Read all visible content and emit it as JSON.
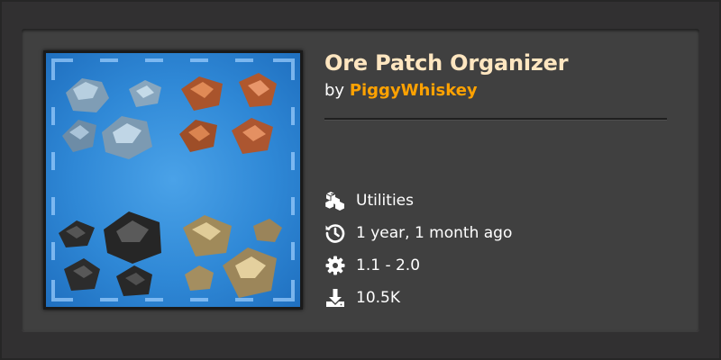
{
  "mod": {
    "title": "Ore Patch Organizer",
    "by_label": "by",
    "author": "PiggyWhiskey"
  },
  "meta": [
    {
      "icon": "cubes-icon",
      "text": "Utilities"
    },
    {
      "icon": "history-icon",
      "text": "1 year, 1 month ago"
    },
    {
      "icon": "gear-icon",
      "text": "1.1 - 2.0"
    },
    {
      "icon": "download-icon",
      "text": "10.5K"
    }
  ],
  "thumbnail": {
    "icon": "ore-patches-thumbnail",
    "ores": [
      "iron",
      "copper",
      "coal",
      "stone"
    ]
  },
  "colors": {
    "title": "#ffe6c0",
    "author": "#ffa200",
    "card_bg": "#404040",
    "page_bg": "#313031",
    "thumb_blue": "#2f88d6"
  }
}
